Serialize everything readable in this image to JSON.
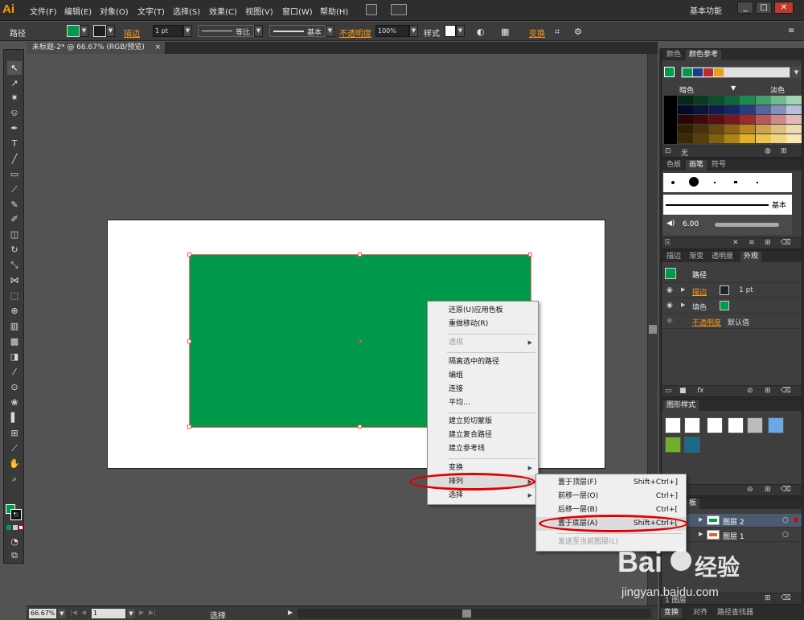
{
  "menubar": {
    "logo": "Ai",
    "items": [
      "文件(F)",
      "编辑(E)",
      "对象(O)",
      "文字(T)",
      "选择(S)",
      "效果(C)",
      "视图(V)",
      "窗口(W)",
      "帮助(H)"
    ],
    "workspace": "基本功能",
    "minimize": "_",
    "restore": "□",
    "close": "✕"
  },
  "controlbar": {
    "selection_type": "路径",
    "stroke_label": "描边",
    "stroke_weight": "1 pt",
    "profile_label": "等比",
    "brush_label": "基本",
    "opacity_label": "不透明度",
    "opacity_value": "100%",
    "style_label": "样式",
    "transform_label": "变换"
  },
  "document": {
    "tab_title": "未标题-2* @ 66.67% (RGB/预览)",
    "tab_close": "×",
    "fill_color": "#009a4a"
  },
  "statusbar": {
    "zoom": "66.67%",
    "page": "1",
    "status": "选择"
  },
  "panels": {
    "color_tabs": [
      "颜色",
      "颜色参考"
    ],
    "color_dark_label": "暗色",
    "color_light_label": "淡色",
    "color_none_label": "无",
    "harmony_colors": [
      "#009a4a",
      "#1a3a8a",
      "#c0282e",
      "#e6a020"
    ],
    "brush_tabs": [
      "色板",
      "画笔",
      "符号"
    ],
    "brush_basic": "基本",
    "brush_size": "6.00",
    "appearance_tabs": [
      "描边",
      "渐变",
      "透明度",
      "外观"
    ],
    "appearance_title": "路径",
    "appearance_stroke_label": "描边",
    "appearance_stroke_value": "1 pt",
    "appearance_fill_label": "填色",
    "appearance_opacity_label": "不透明度",
    "appearance_opacity_value": "默认值",
    "graphic_styles_tab": "图形样式",
    "layers_tab": "板",
    "layers": [
      {
        "name": "图层 2",
        "color": "#3a7bd5"
      },
      {
        "name": "图层 1",
        "color": "#e04040"
      }
    ],
    "layers_footer": "1 图层",
    "bottom_tabs": [
      "变换",
      "对齐",
      "路径查找器"
    ]
  },
  "context_menu": {
    "items": [
      {
        "label": "还原(U)应用色板",
        "disabled": false,
        "submenu": false
      },
      {
        "label": "重做移动(R)",
        "disabled": false,
        "submenu": false
      },
      {
        "label": "透视",
        "disabled": true,
        "submenu": true
      },
      {
        "label": "隔离选中的路径",
        "disabled": false,
        "submenu": false
      },
      {
        "label": "编组",
        "disabled": false,
        "submenu": false
      },
      {
        "label": "连接",
        "disabled": false,
        "submenu": false
      },
      {
        "label": "平均...",
        "disabled": false,
        "submenu": false
      },
      {
        "label": "建立剪切蒙版",
        "disabled": false,
        "submenu": false
      },
      {
        "label": "建立复合路径",
        "disabled": false,
        "submenu": false
      },
      {
        "label": "建立参考线",
        "disabled": false,
        "submenu": false
      },
      {
        "label": "变换",
        "disabled": false,
        "submenu": true
      },
      {
        "label": "排列",
        "disabled": false,
        "submenu": true
      },
      {
        "label": "选择",
        "disabled": false,
        "submenu": true
      }
    ]
  },
  "arrange_submenu": {
    "items": [
      {
        "label": "置于顶层(F)",
        "shortcut": "Shift+Ctrl+]",
        "disabled": false
      },
      {
        "label": "前移一层(O)",
        "shortcut": "Ctrl+]",
        "disabled": false
      },
      {
        "label": "后移一层(B)",
        "shortcut": "Ctrl+[",
        "disabled": false
      },
      {
        "label": "置于底层(A)",
        "shortcut": "Shift+Ctrl+[",
        "disabled": false
      },
      {
        "label": "发送至当前图层(L)",
        "shortcut": "",
        "disabled": true
      }
    ]
  },
  "watermark": {
    "brand": "Bai",
    "brand_tail": "经验",
    "url": "jingyan.baidu.com"
  }
}
